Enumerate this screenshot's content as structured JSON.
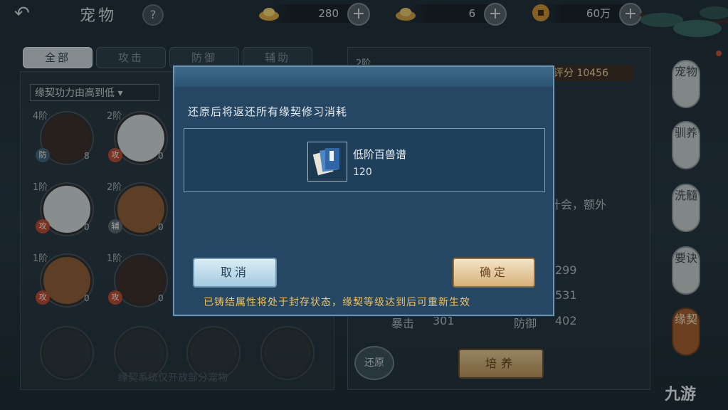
{
  "header": {
    "back_icon": "back-arrow-icon",
    "title": "宠物",
    "help": "?"
  },
  "resources": [
    {
      "icon": "gold-ingot-icon",
      "value": "280"
    },
    {
      "icon": "silver-ingot-icon",
      "value": "6"
    },
    {
      "icon": "copper-coin-icon",
      "value": "60万"
    }
  ],
  "tabs": [
    "全部",
    "攻击",
    "防御",
    "辅助"
  ],
  "sort_select": "缘契功力由高到低",
  "pets": [
    {
      "stage": "4阶",
      "badge": "防",
      "count": "8"
    },
    {
      "stage": "2阶",
      "badge": "攻",
      "count": "0"
    },
    {
      "stage": "1阶",
      "badge": "攻",
      "count": "0"
    },
    {
      "stage": "2阶",
      "badge": "辅",
      "count": "0"
    },
    {
      "stage": "1阶",
      "badge": "攻",
      "count": "0"
    },
    {
      "stage": "1阶",
      "badge": "攻",
      "count": "0"
    }
  ],
  "left_footnote": "缘契系统仅开放部分宠物",
  "right_panel": {
    "stage_tag": "2阶",
    "score_label": "评分",
    "score": "10456",
    "desc_fragment": "计会，额外",
    "stats": [
      {
        "label": "",
        "value": "299"
      },
      {
        "label": "",
        "value": "531"
      },
      {
        "label": "暴击",
        "value": "301"
      },
      {
        "label": "防御",
        "value": "402"
      }
    ],
    "restore_button": "还原",
    "cultivate_button": "培养"
  },
  "side_tabs": [
    "宠物",
    "驯养",
    "洗髓",
    "要诀",
    "缘契"
  ],
  "dialog": {
    "message": "还原后将返还所有缘契修习消耗",
    "item": {
      "name": "低阶百兽谱",
      "count": "120"
    },
    "cancel_label": "取消",
    "confirm_label": "确定",
    "note": "已铸结属性将处于封存状态，缘契等级达到后可重新生效"
  },
  "watermark": "九游",
  "colors": {
    "dialog_bg": "#254763",
    "note": "#f3c35a",
    "accent_gold": "#d8b27a"
  }
}
